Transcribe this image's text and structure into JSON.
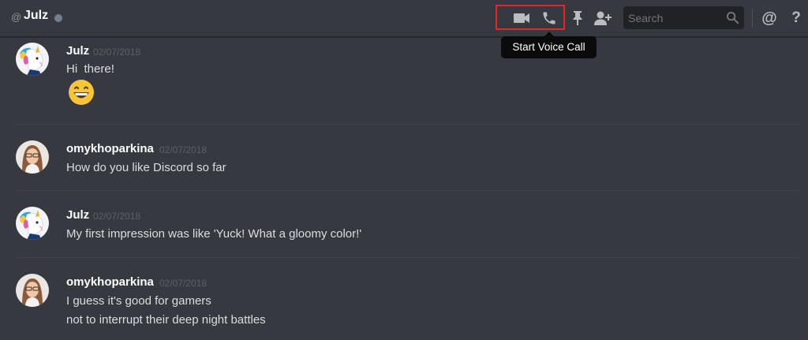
{
  "header": {
    "at_symbol": "@",
    "channel_name": "Julz",
    "status_color": "#747f8d",
    "icons": [
      "video-camera-icon",
      "phone-icon",
      "pin-icon",
      "add-friend-icon"
    ],
    "search_placeholder": "Search",
    "mention_symbol": "@",
    "help_symbol": "?",
    "highlight_color": "#e8251f"
  },
  "tooltip": {
    "text": "Start Voice Call"
  },
  "messages": [
    {
      "author": "Julz",
      "timestamp": "02/07/2018",
      "lines": [
        "Hi  there!"
      ],
      "emoji": "grinning-face-icon"
    },
    {
      "author": "omykhoparkina",
      "timestamp": "02/07/2018",
      "lines": [
        "How do you like Discord so far"
      ]
    },
    {
      "author": "Julz",
      "timestamp": "02/07/2018",
      "lines": [
        "My first impression was like 'Yuck! What a gloomy color!'"
      ]
    },
    {
      "author": "omykhoparkina",
      "timestamp": "02/07/2018",
      "lines": [
        "I guess it's good for gamers",
        "not to interrupt their deep night battles"
      ]
    }
  ]
}
